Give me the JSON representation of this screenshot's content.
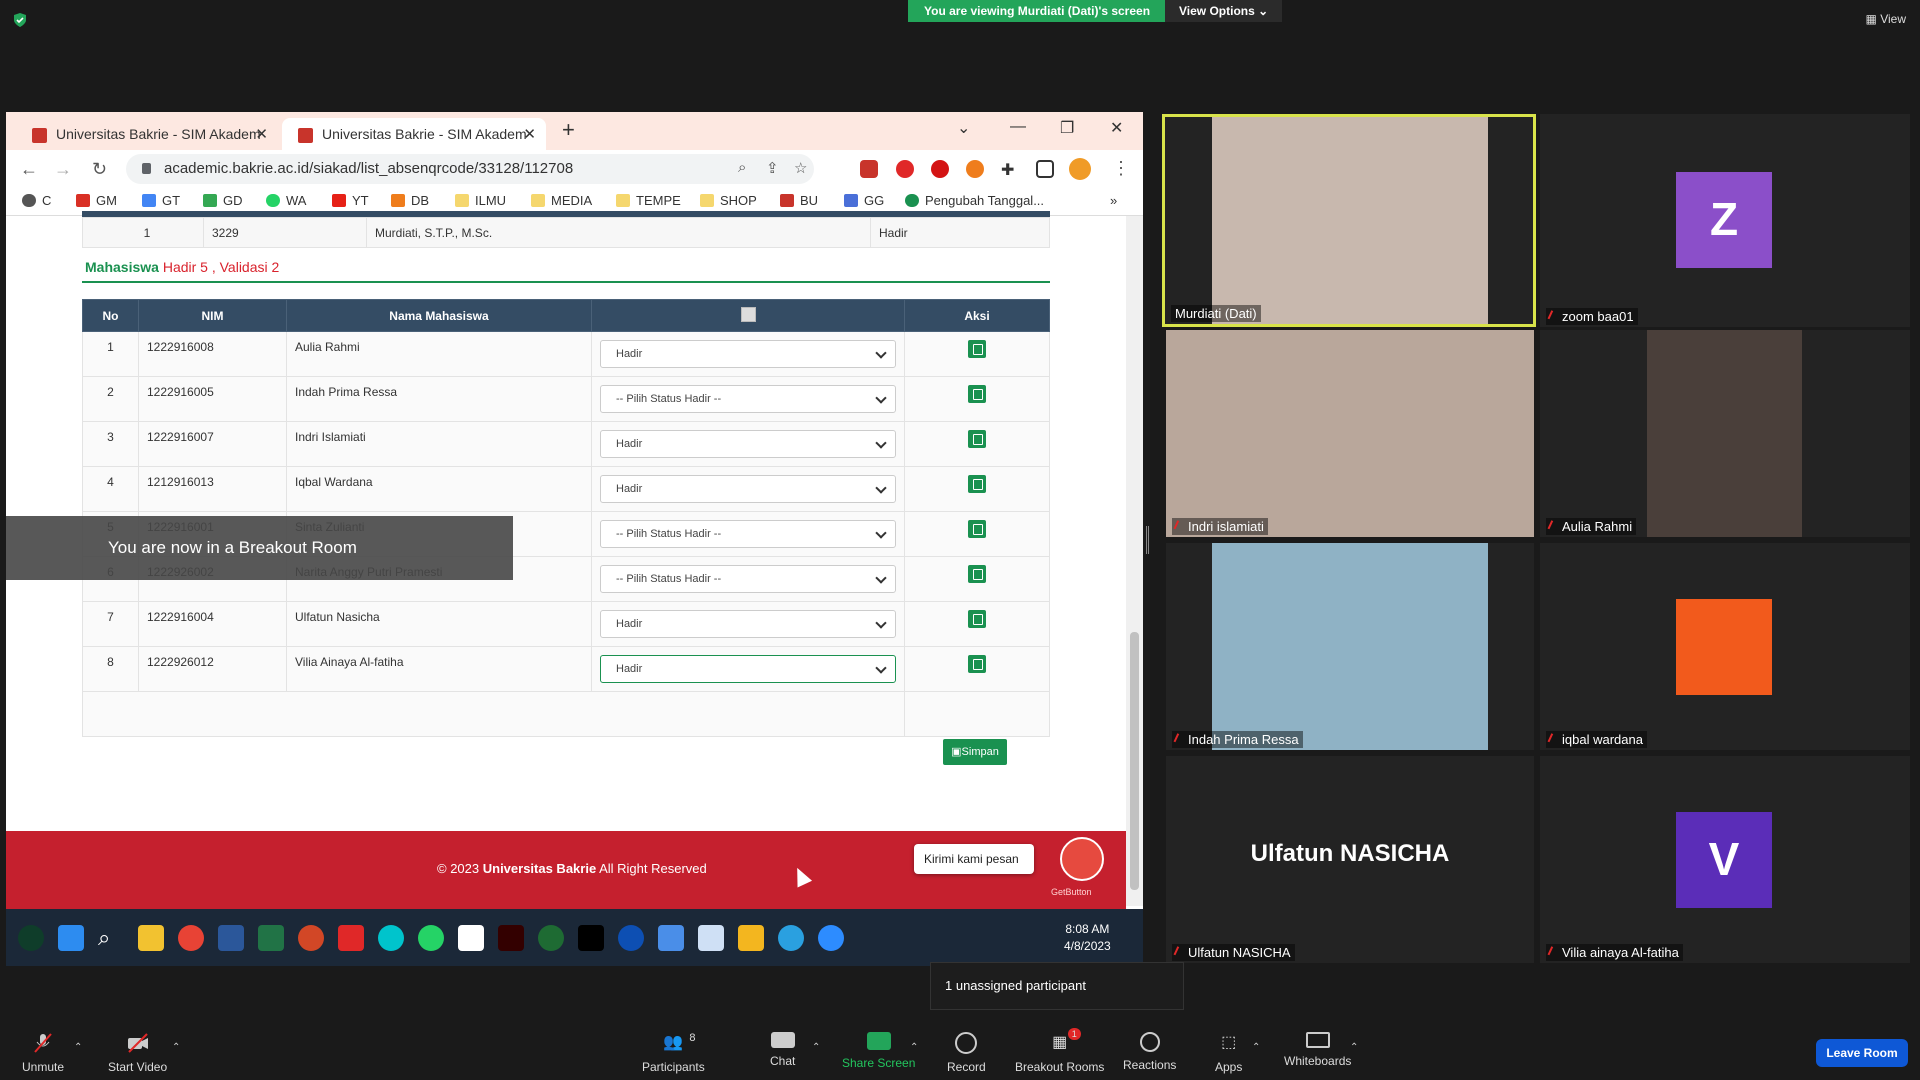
{
  "zoom_top": {
    "viewing_banner": "You are viewing Murdiati (Dati)'s screen",
    "view_options": "View Options",
    "view_label": "View"
  },
  "browser": {
    "tabs": [
      {
        "title": "Universitas Bakrie - SIM Akadem"
      },
      {
        "title": "Universitas Bakrie - SIM Akadem"
      }
    ],
    "url": "academic.bakrie.ac.id/siakad/list_absenqrcode/33128/112708",
    "bookmarks": [
      "C",
      "GM",
      "GT",
      "GD",
      "WA",
      "YT",
      "DB",
      "ILMU",
      "MEDIA",
      "TEMPE",
      "SHOP",
      "BU",
      "GG",
      "Pengubah Tanggal..."
    ],
    "bookmark_more": "»"
  },
  "page": {
    "dosen_row": {
      "no": "1",
      "nip": "3229",
      "name": "Murdiati, S.T.P., M.Sc.",
      "status": "Hadir"
    },
    "mhs_title": "Mahasiswa",
    "mhs_summary": "Hadir 5 , Validasi 2",
    "columns": {
      "no": "No",
      "nim": "NIM",
      "name": "Nama Mahasiswa",
      "aksi": "Aksi"
    },
    "students": [
      {
        "no": "1",
        "nim": "1222916008",
        "name": "Aulia Rahmi",
        "status": "Hadir"
      },
      {
        "no": "2",
        "nim": "1222916005",
        "name": "Indah Prima Ressa",
        "status": "-- Pilih Status Hadir --"
      },
      {
        "no": "3",
        "nim": "1222916007",
        "name": "Indri Islamiati",
        "status": "Hadir"
      },
      {
        "no": "4",
        "nim": "1212916013",
        "name": "Iqbal Wardana",
        "status": "Hadir"
      },
      {
        "no": "5",
        "nim": "1222916001",
        "name": "Sinta Zulianti",
        "status": "-- Pilih Status Hadir --"
      },
      {
        "no": "6",
        "nim": "1222926002",
        "name": "Narita Anggy Putri Pramesti",
        "status": "-- Pilih Status Hadir --"
      },
      {
        "no": "7",
        "nim": "1222916004",
        "name": "Ulfatun Nasicha",
        "status": "Hadir"
      },
      {
        "no": "8",
        "nim": "1222926012",
        "name": "Vilia Ainaya Al-fatiha",
        "status": "Hadir"
      }
    ],
    "simpan": "Simpan",
    "footer_prefix": "© 2023 ",
    "footer_brand": "Universitas Bakrie",
    "footer_suffix": " All Right Reserved",
    "chat_prompt": "Kirimi kami pesan",
    "getbutton": "GetButton",
    "breakout_toast": "You are now in a Breakout Room"
  },
  "taskbar": {
    "time": "8:08 AM",
    "date": "4/8/2023"
  },
  "gallery": {
    "tiles": [
      {
        "name": "Murdiati (Dati)"
      },
      {
        "name": "zoom baa01",
        "initial": "Z",
        "color": "#8b4fc9"
      },
      {
        "name": "Indri islamiati"
      },
      {
        "name": "Aulia Rahmi"
      },
      {
        "name": "Indah Prima Ressa"
      },
      {
        "name": "iqbal wardana"
      },
      {
        "name": "Ulfatun NASICHA",
        "display": "Ulfatun NASICHA"
      },
      {
        "name": "Vilia ainaya Al-fatiha",
        "initial": "V",
        "color": "#5b2db8"
      }
    ],
    "unassigned": "1 unassigned participant"
  },
  "controls": {
    "unmute": "Unmute",
    "start_video": "Start Video",
    "participants": "Participants",
    "participants_count": "8",
    "chat": "Chat",
    "share": "Share Screen",
    "record": "Record",
    "breakout": "Breakout Rooms",
    "breakout_badge": "1",
    "reactions": "Reactions",
    "apps": "Apps",
    "whiteboards": "Whiteboards",
    "leave": "Leave Room"
  },
  "colors": {
    "accent_green": "#1a9150",
    "footer_red": "#c5202e",
    "zoom_blue": "#0e58d6",
    "active_border": "#d8e34a"
  }
}
